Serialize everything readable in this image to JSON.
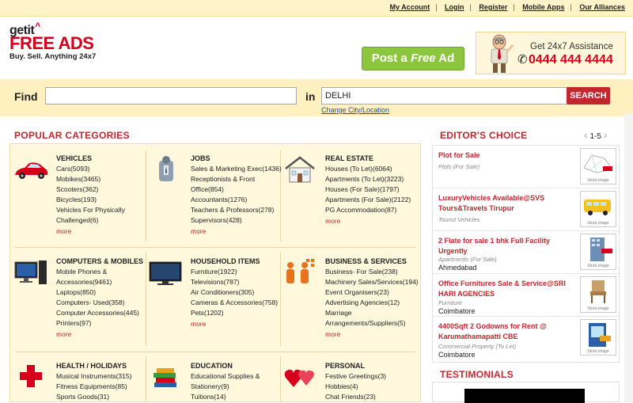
{
  "top_links": [
    "My Account",
    "Login",
    "Register",
    "Mobile Apps",
    "Our Alliances"
  ],
  "logo": {
    "line1": "getit",
    "line2": "FREE ADS",
    "tagline": "Buy. Sell. Anything 24x7"
  },
  "post_ad": {
    "pre": "Post a ",
    "em": "Free",
    "post": " Ad"
  },
  "assistance": {
    "title": "Get 24x7 Assistance",
    "phone": "0444 444 4444"
  },
  "search": {
    "find_label": "Find",
    "in_label": "in",
    "city": "DELHI",
    "button": "SEARCH",
    "change_city": "Change City/Location"
  },
  "popular_title": "POPULAR CATEGORIES",
  "categories": [
    {
      "title": "VEHICLES",
      "items": [
        "Cars(5093)",
        "Mobikes(3465)",
        "Scooters(362)",
        "Bicycles(193)",
        "Vehicles For Physically Challenged(6)"
      ],
      "more": "more"
    },
    {
      "title": "JOBS",
      "items": [
        "Sales & Marketing Exec(1436)",
        "Receptionists & Front Office(854)",
        "Accountants(1276)",
        "Teachers & Professors(278)",
        "Supervisors(428)"
      ],
      "more": "more"
    },
    {
      "title": "REAL ESTATE",
      "items": [
        "Houses (To Let)(6064)",
        "Apartments (To Let)(3223)",
        "Houses (For Sale)(1797)",
        "Apartments (For Sale)(2122)",
        "PG Accommodation(87)"
      ],
      "more": "more"
    },
    {
      "title": "COMPUTERS & MOBILES",
      "items": [
        "Mobile Phones & Accessories(9461)",
        "Laptops(850)",
        "Computers- Used(358)",
        "Computer Accessories(445)",
        "Printers(97)"
      ],
      "more": "more"
    },
    {
      "title": "HOUSEHOLD ITEMS",
      "items": [
        "Furniture(1922)",
        "Televisions(787)",
        "Air Conditioners(305)",
        "Cameras & Accessories(758)",
        "Pets(1202)"
      ],
      "more": "more"
    },
    {
      "title": "BUSINESS & SERVICES",
      "items": [
        "Business- For Sale(238)",
        "Machinery Sales/Services(194)",
        "Event Organisers(23)",
        "Advertising Agencies(12)",
        "Marriage Arrangements/Suppliers(5)"
      ],
      "more": "more"
    },
    {
      "title": "HEALTH / HOLIDAYS",
      "items": [
        "Musical Instruments(315)",
        "Fitness Equipments(85)",
        "Sports Goods(31)"
      ],
      "more": ""
    },
    {
      "title": "EDUCATION",
      "items": [
        "Educational Supplies & Stationery(9)",
        "Tuitions(14)"
      ],
      "more": ""
    },
    {
      "title": "PERSONAL",
      "items": [
        "Festive Greetings(3)",
        "Hobbies(4)",
        "Chat Friends(23)"
      ],
      "more": ""
    }
  ],
  "editors_choice": {
    "title": "EDITOR'S CHOICE",
    "page": "1-5",
    "items": [
      {
        "title": "Plot for Sale",
        "category": "Plots (For Sale)",
        "location": ""
      },
      {
        "title": "LuxuryVehicles Available@SVS Tours&Travels Tirupur",
        "category": "Tourist Vehicles",
        "location": ""
      },
      {
        "title": "2 Flate for sale 1 bhk Full Facility Urgently",
        "category": "Apartments (For Sale)",
        "location": "Ahmedabad"
      },
      {
        "title": "Office Furnitures Sale & Service@SRI HARI AGENCIES",
        "category": "Furniture",
        "location": "Coimbatore"
      },
      {
        "title": "4400Sqft 2 Godowns for Rent @ Karumathamapatti CBE",
        "category": "Commercial Property (To Let)",
        "location": "Coimbatore"
      }
    ],
    "thumb_label": "Stock image"
  },
  "testimonials_title": "TESTIMONIALS",
  "colors": {
    "accent": "#c1272d",
    "post_ad": "#8cc63f",
    "panel": "#fff8dd",
    "bar": "#fff0bf"
  }
}
